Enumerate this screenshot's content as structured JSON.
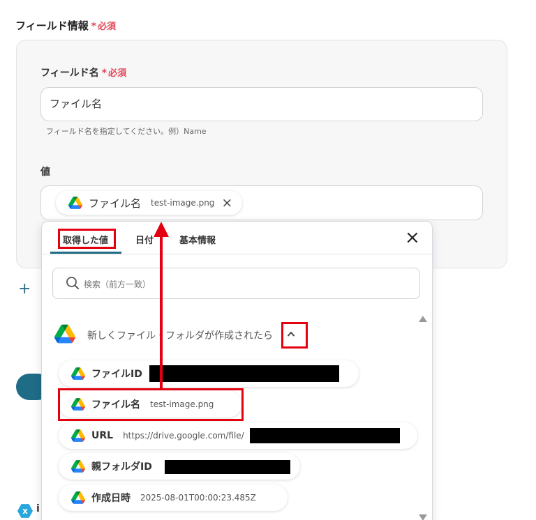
{
  "section": {
    "title": "フィールド情報",
    "required_star": "*",
    "required_text": "必須"
  },
  "field_name": {
    "label": "フィールド名",
    "required_star": "*",
    "required_text": "必須",
    "value": "ファイル名",
    "hint": "フィールド名を指定してください。例）Name"
  },
  "value_field": {
    "label": "値",
    "chip_name": "ファイル名",
    "chip_value": "test-image.png",
    "chip_close": "×"
  },
  "dropdown": {
    "tabs": [
      {
        "label": "取得した値"
      },
      {
        "label": "日付"
      },
      {
        "label": "基本情報"
      }
    ],
    "close": "×",
    "search_placeholder": "検索（前方一致）",
    "group_title": "新しくファイル・フォルダが作成されたら",
    "items": [
      {
        "name": "ファイルID",
        "value": ""
      },
      {
        "name": "ファイル名",
        "value": "test-image.png"
      },
      {
        "name": "URL",
        "value": "https://drive.google.com/file/"
      },
      {
        "name": "親フォルダID",
        "value": ""
      },
      {
        "name": "作成日時",
        "value": "2025-08-01T00:00:23.485Z"
      }
    ]
  },
  "bottom": {
    "plus": "+",
    "badge": "x",
    "edge_text": "i"
  },
  "colors": {
    "accent": "#1f6c86",
    "required": "#e04a5b",
    "highlight": "#e3000f",
    "panel_bg": "#f7f7f8"
  },
  "icons": {
    "drive": "google-drive-icon",
    "search": "search-icon",
    "close": "close-icon",
    "chevron": "chevron-up-icon",
    "plus": "plus-icon"
  }
}
